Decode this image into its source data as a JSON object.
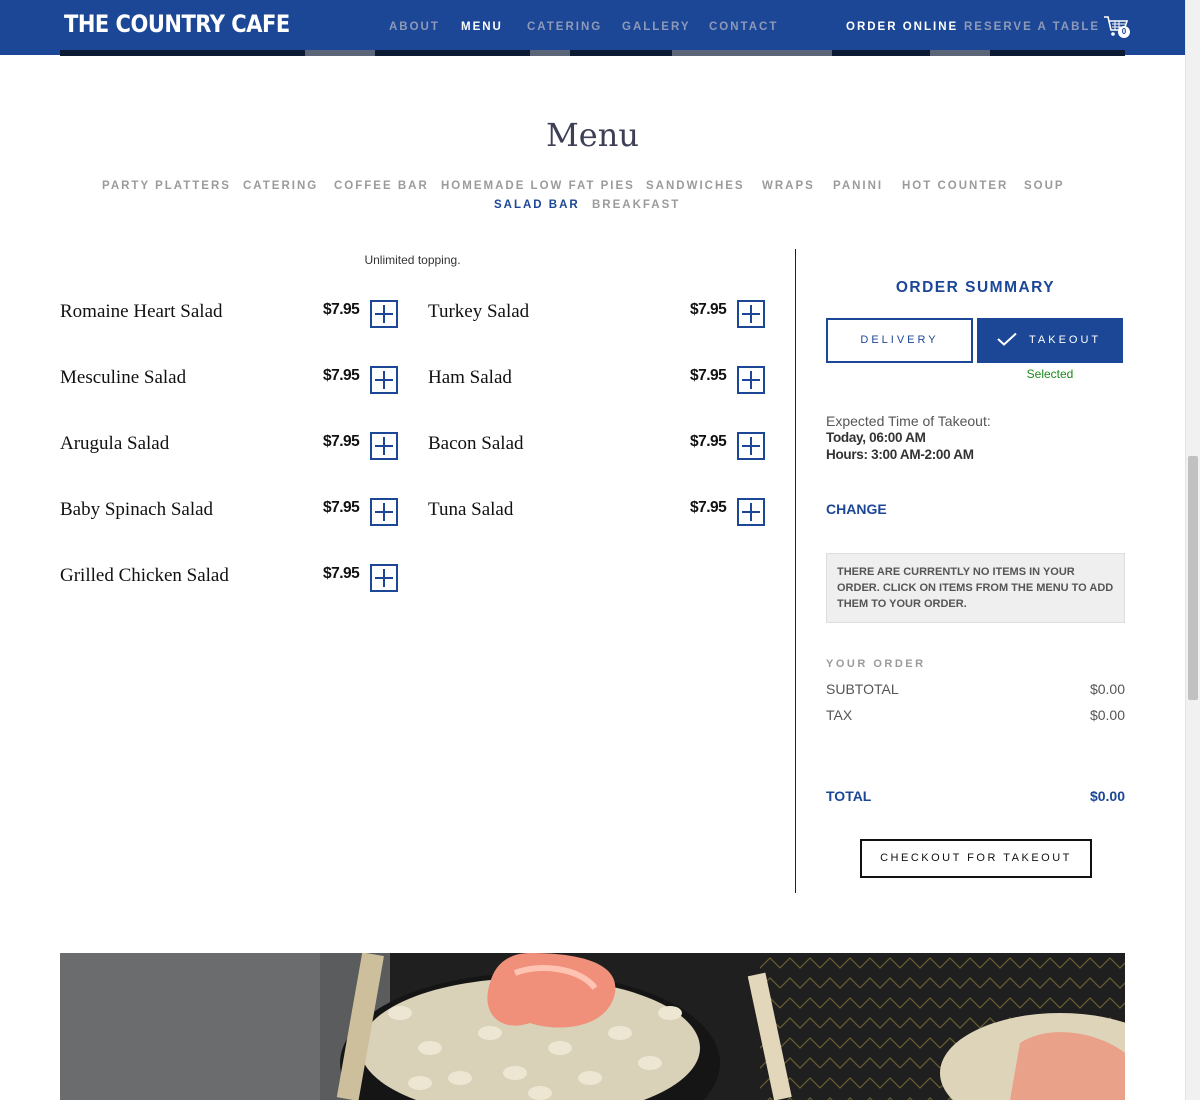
{
  "header": {
    "logo": "THE COUNTRY CAFE",
    "nav": [
      {
        "label": "ABOUT",
        "active": false
      },
      {
        "label": "MENU",
        "active": true
      },
      {
        "label": "CATERING",
        "active": false
      },
      {
        "label": "GALLERY",
        "active": false
      },
      {
        "label": "CONTACT",
        "active": false
      }
    ],
    "order_online": "ORDER ONLINE",
    "reserve": "RESERVE A TABLE",
    "cart_count": "0",
    "cart_icon": "shopping-cart-icon"
  },
  "menu": {
    "title": "Menu",
    "categories": [
      {
        "label": "PARTY PLATTERS",
        "active": false
      },
      {
        "label": "CATERING",
        "active": false
      },
      {
        "label": "COFFEE BAR",
        "active": false
      },
      {
        "label": "HOMEMADE LOW FAT PIES",
        "active": false
      },
      {
        "label": "SANDWICHES",
        "active": false
      },
      {
        "label": "WRAPS",
        "active": false
      },
      {
        "label": "PANINI",
        "active": false
      },
      {
        "label": "HOT COUNTER",
        "active": false
      },
      {
        "label": "SOUP",
        "active": false
      },
      {
        "label": "SALAD BAR",
        "active": true
      },
      {
        "label": "BREAKFAST",
        "active": false
      }
    ],
    "note": "Unlimited topping.",
    "items": [
      {
        "name": "Romaine Heart Salad",
        "price": "$7.95"
      },
      {
        "name": "Turkey Salad",
        "price": "$7.95"
      },
      {
        "name": "Mesculine Salad",
        "price": "$7.95"
      },
      {
        "name": "Ham Salad",
        "price": "$7.95"
      },
      {
        "name": "Arugula Salad",
        "price": "$7.95"
      },
      {
        "name": "Bacon Salad",
        "price": "$7.95"
      },
      {
        "name": "Baby Spinach Salad",
        "price": "$7.95"
      },
      {
        "name": "Tuna Salad",
        "price": "$7.95"
      },
      {
        "name": "Grilled Chicken Salad",
        "price": "$7.95"
      }
    ],
    "add_icon": "plus-icon"
  },
  "order_summary": {
    "title": "ORDER SUMMARY",
    "delivery_label": "DELIVERY",
    "takeout_label": "TAKEOUT",
    "selected_label": "Selected",
    "check_icon": "checkmark-icon",
    "expected_label": "Expected Time of Takeout:",
    "expected_time": "Today, 06:00 AM",
    "hours": "Hours: 3:00 AM-2:00 AM",
    "change_label": "CHANGE",
    "empty_message": "THERE ARE CURRENTLY NO ITEMS IN YOUR ORDER. CLICK ON ITEMS FROM THE MENU TO ADD THEM TO YOUR ORDER.",
    "your_order_label": "YOUR ORDER",
    "subtotal_label": "SUBTOTAL",
    "subtotal_value": "$0.00",
    "tax_label": "TAX",
    "tax_value": "$0.00",
    "total_label": "TOTAL",
    "total_value": "$0.00",
    "checkout_label": "CHECKOUT FOR TAKEOUT"
  },
  "colors": {
    "brand_blue": "#1c4696",
    "selected_green": "#1b8a1b"
  }
}
